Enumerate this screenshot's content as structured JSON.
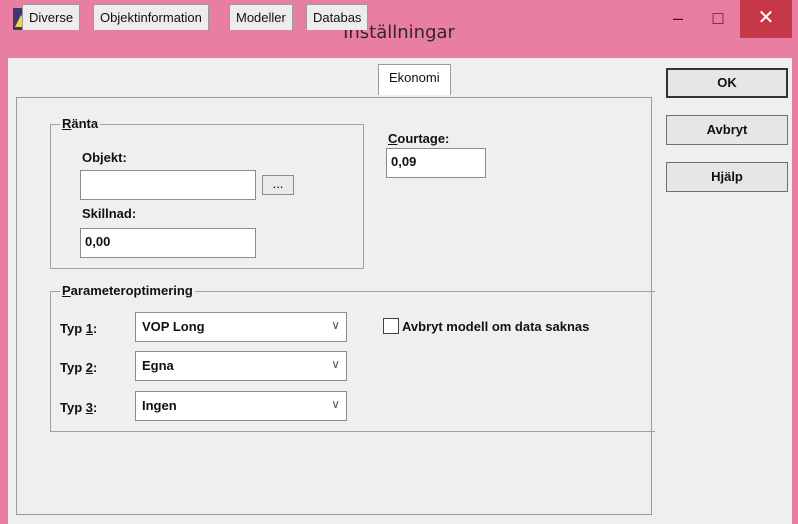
{
  "window": {
    "title": "Inställningar",
    "minimize_glyph": "–",
    "maximize_glyph": "□",
    "close_glyph": "✕"
  },
  "tabs": [
    {
      "label": "Diverse"
    },
    {
      "label": "Objektinformation"
    },
    {
      "label": "Modeller"
    },
    {
      "label": "Databas"
    },
    {
      "label": "Ekonomi",
      "active": true
    }
  ],
  "ranta": {
    "legend_first": "R",
    "legend_rest": "änta",
    "objekt_label": "Objekt:",
    "objekt_value": "",
    "browse_label": "...",
    "skillnad_label": "Skillnad:",
    "skillnad_value": "0,00"
  },
  "courtage": {
    "label_first": "C",
    "label_rest": "ourtage:",
    "value": "0,09"
  },
  "parameteroptimering": {
    "legend_first": "P",
    "legend_rest": "arameteroptimering",
    "rows": [
      {
        "label_pre": "Typ ",
        "label_key": "1",
        "label_post": ":",
        "value": "VOP Long"
      },
      {
        "label_pre": "Typ ",
        "label_key": "2",
        "label_post": ":",
        "value": "Egna"
      },
      {
        "label_pre": "Typ ",
        "label_key": "3",
        "label_post": ":",
        "value": "Ingen"
      }
    ],
    "checkbox_label": "Avbryt modell om data saknas",
    "checkbox_checked": false
  },
  "buttons": {
    "ok": "OK",
    "cancel": "Avbryt",
    "help": "Hjälp"
  }
}
